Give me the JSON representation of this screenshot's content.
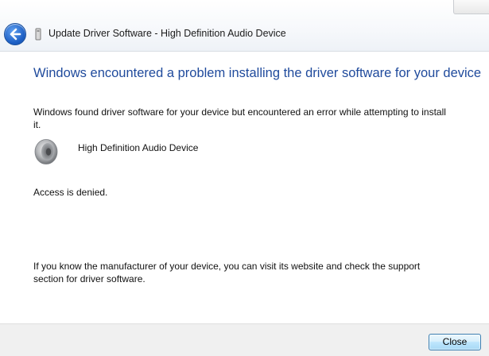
{
  "window": {
    "title": "Update Driver Software - High Definition Audio Device"
  },
  "content": {
    "headline": "Windows encountered a problem installing the driver software for your device",
    "intro": "Windows found driver software for your device but encountered an error while attempting to install it.",
    "device_name": "High Definition Audio Device",
    "error_message": "Access is denied.",
    "footer_note": "If you know the manufacturer of your device, you can visit its website and check the support section for driver software."
  },
  "buttons": {
    "close_label": "Close"
  },
  "icons": {
    "back": "back-arrow-icon",
    "device": "device-icon",
    "speaker": "speaker-icon"
  },
  "colors": {
    "headline": "#1f4a9c",
    "back_button": "#1d5fc4",
    "close_button_border": "#3c7fb1"
  }
}
